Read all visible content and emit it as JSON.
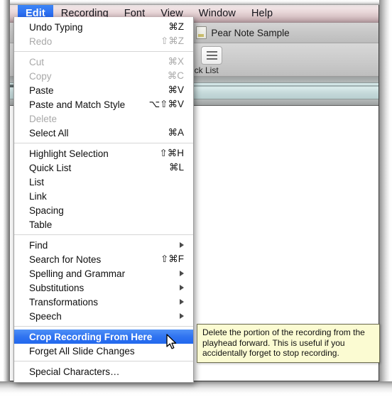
{
  "app": {
    "menubar": {
      "items": [
        {
          "label": "Edit",
          "active": true
        },
        {
          "label": "Recording",
          "active": false
        },
        {
          "label": "Font",
          "active": false
        },
        {
          "label": "View",
          "active": false
        },
        {
          "label": "Window",
          "active": false
        },
        {
          "label": "Help",
          "active": false
        }
      ],
      "accent_color": "#2c6ff2",
      "bar_color": "#e8d6d8"
    },
    "document": {
      "title": "Pear Note Sample",
      "icon": "document-icon"
    },
    "toolbar": {
      "quick_list_button_icon": "list-lines-icon",
      "quick_list_label": "ick List"
    },
    "timeline": {
      "playhead_icon": "playhead-knob-icon",
      "track_color": "#cfe2e3"
    }
  },
  "edit_menu": {
    "title": "Edit",
    "groups": [
      {
        "items": [
          {
            "label": "Undo Typing",
            "shortcut": "⌘Z",
            "disabled": false,
            "submenu": false,
            "selected": false
          },
          {
            "label": "Redo",
            "shortcut": "⇧⌘Z",
            "disabled": true,
            "submenu": false,
            "selected": false
          }
        ]
      },
      {
        "items": [
          {
            "label": "Cut",
            "shortcut": "⌘X",
            "disabled": true,
            "submenu": false,
            "selected": false
          },
          {
            "label": "Copy",
            "shortcut": "⌘C",
            "disabled": true,
            "submenu": false,
            "selected": false
          },
          {
            "label": "Paste",
            "shortcut": "⌘V",
            "disabled": false,
            "submenu": false,
            "selected": false
          },
          {
            "label": "Paste and Match Style",
            "shortcut": "⌥⇧⌘V",
            "disabled": false,
            "submenu": false,
            "selected": false
          },
          {
            "label": "Delete",
            "shortcut": "",
            "disabled": true,
            "submenu": false,
            "selected": false
          },
          {
            "label": "Select All",
            "shortcut": "⌘A",
            "disabled": false,
            "submenu": false,
            "selected": false
          }
        ]
      },
      {
        "items": [
          {
            "label": "Highlight Selection",
            "shortcut": "⇧⌘H",
            "disabled": false,
            "submenu": false,
            "selected": false
          },
          {
            "label": "Quick List",
            "shortcut": "⌘L",
            "disabled": false,
            "submenu": false,
            "selected": false
          },
          {
            "label": "List",
            "shortcut": "",
            "disabled": false,
            "submenu": false,
            "selected": false
          },
          {
            "label": "Link",
            "shortcut": "",
            "disabled": false,
            "submenu": false,
            "selected": false
          },
          {
            "label": "Spacing",
            "shortcut": "",
            "disabled": false,
            "submenu": false,
            "selected": false
          },
          {
            "label": "Table",
            "shortcut": "",
            "disabled": false,
            "submenu": false,
            "selected": false
          }
        ]
      },
      {
        "items": [
          {
            "label": "Find",
            "shortcut": "",
            "disabled": false,
            "submenu": true,
            "selected": false
          },
          {
            "label": "Search for Notes",
            "shortcut": "⇧⌘F",
            "disabled": false,
            "submenu": false,
            "selected": false
          },
          {
            "label": "Spelling and Grammar",
            "shortcut": "",
            "disabled": false,
            "submenu": true,
            "selected": false
          },
          {
            "label": "Substitutions",
            "shortcut": "",
            "disabled": false,
            "submenu": true,
            "selected": false
          },
          {
            "label": "Transformations",
            "shortcut": "",
            "disabled": false,
            "submenu": true,
            "selected": false
          },
          {
            "label": "Speech",
            "shortcut": "",
            "disabled": false,
            "submenu": true,
            "selected": false
          }
        ]
      },
      {
        "items": [
          {
            "label": "Crop Recording From Here",
            "shortcut": "",
            "disabled": false,
            "submenu": false,
            "selected": true
          },
          {
            "label": "Forget All Slide Changes",
            "shortcut": "",
            "disabled": false,
            "submenu": false,
            "selected": false
          }
        ]
      },
      {
        "items": [
          {
            "label": "Special Characters…",
            "shortcut": "",
            "disabled": false,
            "submenu": false,
            "selected": false
          }
        ]
      }
    ]
  },
  "tooltip": {
    "text": "Delete the portion of the recording from the playhead forward. This is useful if you accidentally forget to stop recording.",
    "background_color": "#fbfbd2"
  },
  "cursor": {
    "icon": "mouse-pointer-icon"
  }
}
